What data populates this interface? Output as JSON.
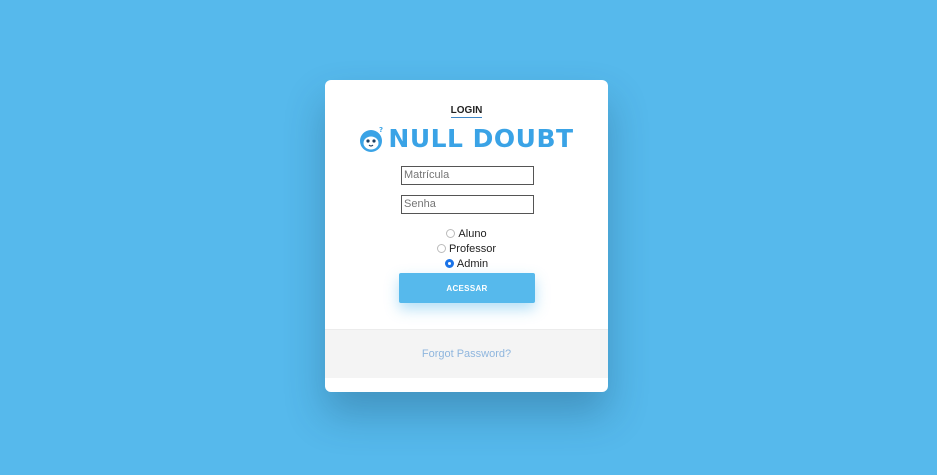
{
  "colors": {
    "background": "#56b9ec",
    "brand": "#3aa3e6",
    "button": "#56b9ec",
    "link": "#8fb6de",
    "radio_checked": "#1a73e8"
  },
  "header": {
    "tab_label": "LOGIN"
  },
  "logo": {
    "icon": "penguin-logo-icon",
    "text": "NULL DOUBT"
  },
  "form": {
    "matricula_placeholder": "Matrícula",
    "matricula_value": "",
    "senha_placeholder": "Senha",
    "senha_value": "",
    "roles": [
      {
        "label": "Aluno",
        "checked": false
      },
      {
        "label": "Professor",
        "checked": false
      },
      {
        "label": "Admin",
        "checked": true
      }
    ],
    "submit_label": "ACESSAR"
  },
  "footer": {
    "forgot_label": "Forgot Password?"
  }
}
